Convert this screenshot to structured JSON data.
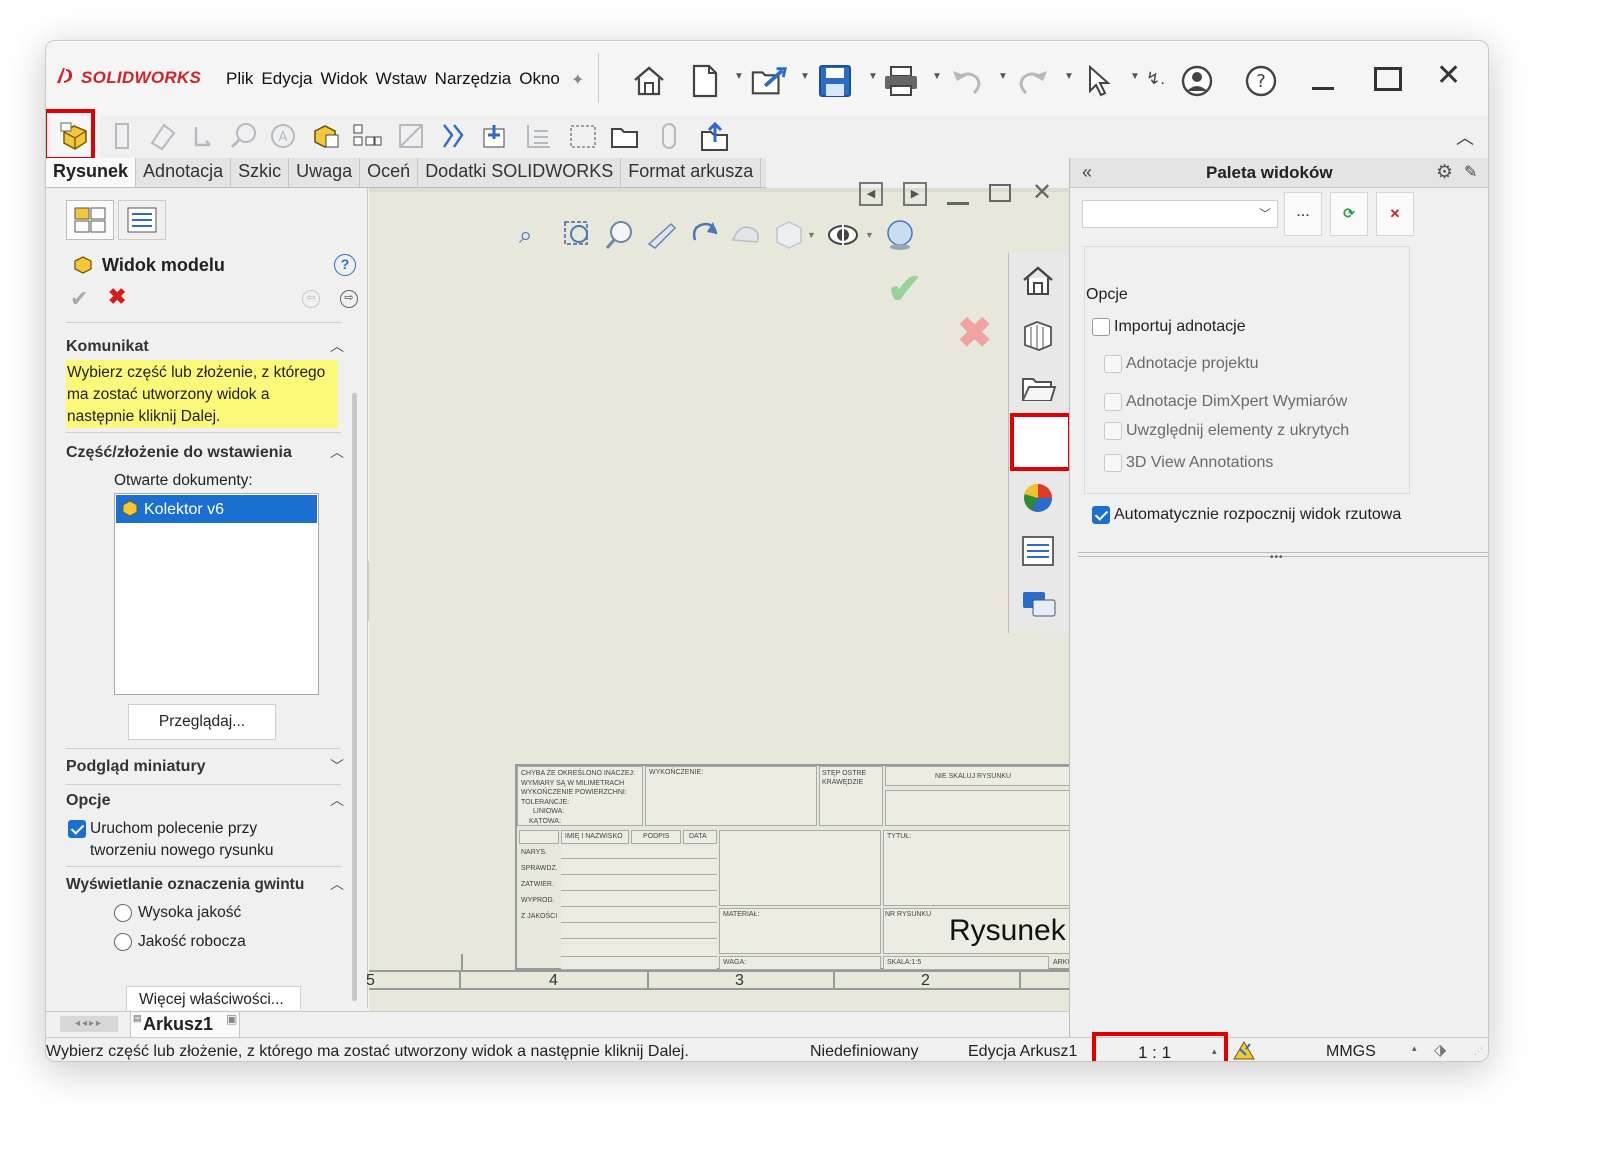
{
  "app": {
    "logo": "SOLIDWORKS"
  },
  "menu": [
    "Plik",
    "Edycja",
    "Widok",
    "Wstaw",
    "Narzędzia",
    "Okno"
  ],
  "tabs": [
    "Rysunek",
    "Adnotacja",
    "Szkic",
    "Uwaga",
    "Oceń",
    "Dodatki SOLIDWORKS",
    "Format arkusza"
  ],
  "left_panel": {
    "title": "Widok modelu",
    "help": "?",
    "komunikat": {
      "header": "Komunikat",
      "message": "Wybierz część lub złożenie, z którego ma zostać utworzony widok a następnie kliknij Dalej."
    },
    "part": {
      "header": "Część/złożenie do wstawienia",
      "open_docs_label": "Otwarte dokumenty:",
      "items": [
        "Kolektor v6"
      ],
      "browse": "Przeglądaj..."
    },
    "thumbnail": {
      "header": "Podgląd miniatury"
    },
    "options": {
      "header": "Opcje",
      "start_cmd": "Uruchom polecenie przy tworzeniu nowego rysunku"
    },
    "thread": {
      "header": "Wyświetlanie oznaczenia gwintu",
      "high": "Wysoka jakość",
      "draft": "Jakość robocza"
    },
    "more": "Więcej właściwości..."
  },
  "sheet_tab": "Arkusz1",
  "title_block": {
    "notes": [
      "CHYBA ŻE OKREŚLONO INACZEJ:",
      "WYMIARY SĄ W MILIMETRACH",
      "WYKOŃCZENIE POWIERZCHNI:",
      "TOLERANCJE:",
      "LINIOWA:",
      "KĄTOWA:"
    ],
    "finish": "WYKOŃCZENIE:",
    "edges": "STĘP OSTRE KRAWĘDZIE",
    "noscale": "NIE SKALUJ RYSUNKU",
    "cols": [
      "IMIĘ I NAZWISKO",
      "PODPIS",
      "DATA"
    ],
    "rows": [
      "NARYS.",
      "SPRAWDZ.",
      "ZATWIER.",
      "WYPROD.",
      "Z JAKOŚCI"
    ],
    "title_lbl": "TYTUŁ:",
    "material": "MATERIAŁ:",
    "drawing_no": "NR RYSUNKU",
    "drawing_name": "Rysunek",
    "weight": "WAGA:",
    "scale": "SKALA:1:5",
    "sheet": "ARKU",
    "zones": [
      "5",
      "4",
      "3",
      "2"
    ]
  },
  "right_panel": {
    "title": "Paleta widoków",
    "browse": "...",
    "options_label": "Opcje",
    "import_annotations": "Importuj adnotacje",
    "project_annotations": "Adnotacje projektu",
    "dimxpert": "Adnotacje DimXpert Wymiarów",
    "hidden": "Uwzględnij elementy z ukrytych",
    "view3d": "3D View Annotations",
    "auto_start": "Automatycznie rozpocznij widok rzutowa"
  },
  "status": {
    "message": "Wybierz część lub złożenie, z którego ma zostać utworzony widok a następnie kliknij Dalej.",
    "state": "Niedefiniowany",
    "edit": "Edycja Arkusz1",
    "scale": "1 : 1",
    "units": "MMGS"
  },
  "colors": {
    "accent": "#1a6fd1",
    "highlight": "#e00000",
    "message_bg": "#fcf87a",
    "brand": "#d2232a"
  }
}
